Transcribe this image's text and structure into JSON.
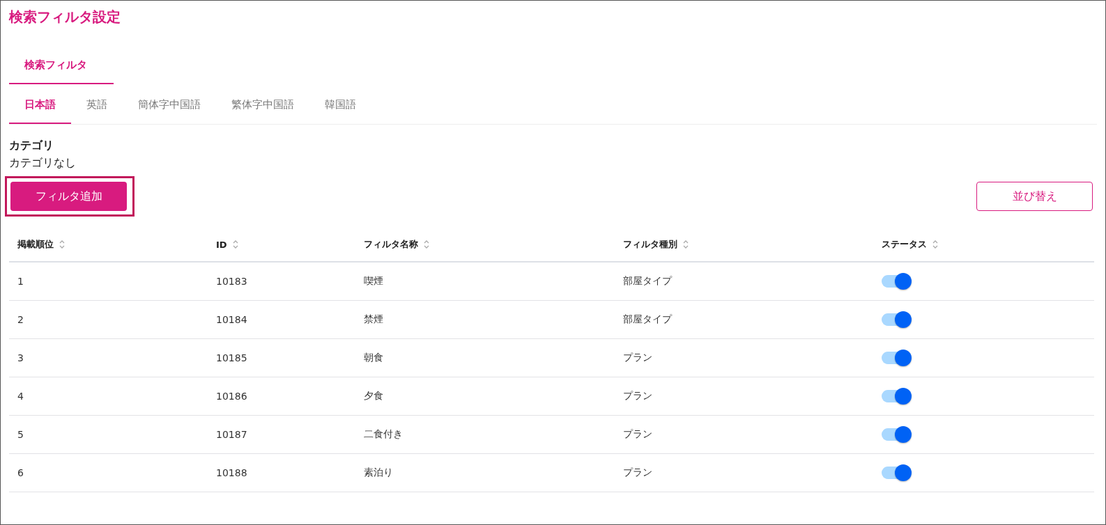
{
  "title": "検索フィルタ設定",
  "section_tabs": [
    {
      "label": "検索フィルタ",
      "selected": true
    }
  ],
  "language_tabs": [
    {
      "label": "日本語",
      "selected": true
    },
    {
      "label": "英語",
      "selected": false
    },
    {
      "label": "簡体字中国語",
      "selected": false
    },
    {
      "label": "繁体字中国語",
      "selected": false
    },
    {
      "label": "韓国語",
      "selected": false
    }
  ],
  "category": {
    "label": "カテゴリ",
    "value": "カテゴリなし"
  },
  "add_button": {
    "label": "フィルタ追加",
    "highlighted": true
  },
  "sort_button": {
    "label": "並び替え"
  },
  "table": {
    "columns": [
      "掲載順位",
      "ID",
      "フィルタ名称",
      "フィルタ種別",
      "ステータス"
    ],
    "rows": [
      {
        "order": "1",
        "id": "10183",
        "name": "喫煙",
        "type": "部屋タイプ",
        "on": true
      },
      {
        "order": "2",
        "id": "10184",
        "name": "禁煙",
        "type": "部屋タイプ",
        "on": true
      },
      {
        "order": "3",
        "id": "10185",
        "name": "朝食",
        "type": "プラン",
        "on": true
      },
      {
        "order": "4",
        "id": "10186",
        "name": "夕食",
        "type": "プラン",
        "on": true
      },
      {
        "order": "5",
        "id": "10187",
        "name": "二食付き",
        "type": "プラン",
        "on": true
      },
      {
        "order": "6",
        "id": "10188",
        "name": "素泊り",
        "type": "プラン",
        "on": true
      }
    ]
  }
}
